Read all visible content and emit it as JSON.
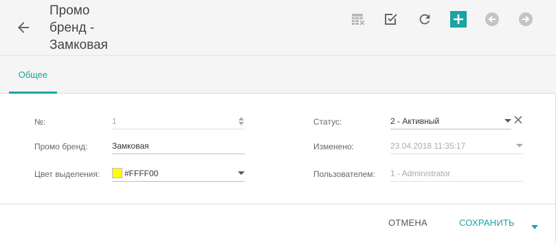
{
  "header": {
    "title_lines": [
      "Промо",
      "бренд -",
      "Замковая"
    ],
    "back_icon": "arrow-left-icon",
    "toolbar": [
      {
        "name": "table-delete-icon",
        "color": "#b8b8b8"
      },
      {
        "name": "checkbox-icon",
        "color": "#666666"
      },
      {
        "name": "refresh-icon",
        "color": "#666666"
      },
      {
        "name": "plus-icon",
        "color": "#1aa3a3"
      },
      {
        "name": "prev-circle-icon",
        "color": "#c4c4c4"
      },
      {
        "name": "next-circle-icon",
        "color": "#c4c4c4"
      }
    ]
  },
  "tabs": [
    {
      "label": "Общее",
      "active": true
    }
  ],
  "form": {
    "left": [
      {
        "label": "№:",
        "value": "1",
        "disabled": true,
        "control": "spinner"
      },
      {
        "label": "Промо бренд:",
        "value": "Замковая",
        "disabled": false,
        "control": "text"
      },
      {
        "label": "Цвет выделения:",
        "value": "#FFFF00",
        "disabled": false,
        "control": "color-select",
        "swatch": "#FFFF00"
      }
    ],
    "right": [
      {
        "label": "Статус:",
        "value": "2 - Активный",
        "disabled": false,
        "control": "select-clear"
      },
      {
        "label": "Изменено:",
        "value": "23.04.2018 11:35:17",
        "disabled": true,
        "control": "select"
      },
      {
        "label": "Пользователем:",
        "value": "1 - Administrator",
        "disabled": true,
        "control": "text"
      }
    ]
  },
  "footer": {
    "cancel_label": "ОТМЕНА",
    "save_label": "СОХРАНИТЬ"
  },
  "colors": {
    "accent": "#1aa3a3",
    "header_bg": "#f5f5f5"
  }
}
